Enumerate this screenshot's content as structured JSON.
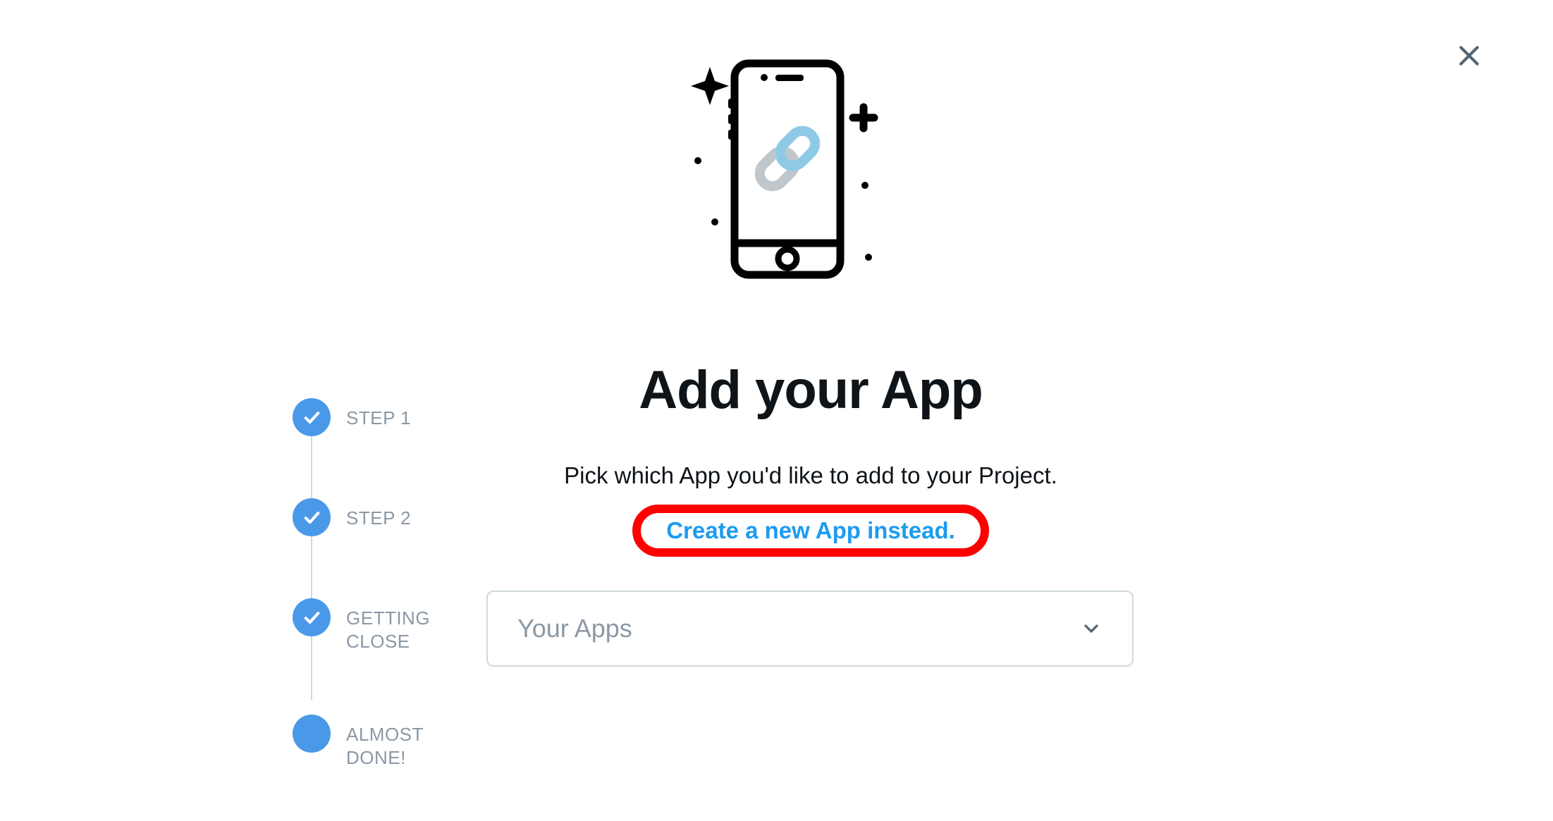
{
  "stepper": {
    "steps": [
      {
        "label": "STEP 1",
        "completed": true
      },
      {
        "label": "STEP 2",
        "completed": true
      },
      {
        "label": "GETTING CLOSE",
        "completed": true
      },
      {
        "label": "ALMOST DONE!",
        "completed": false
      }
    ]
  },
  "main": {
    "title": "Add your App",
    "description": "Pick which App you'd like to add to your Project.",
    "create_link": "Create a new App instead.",
    "dropdown_placeholder": "Your Apps"
  }
}
